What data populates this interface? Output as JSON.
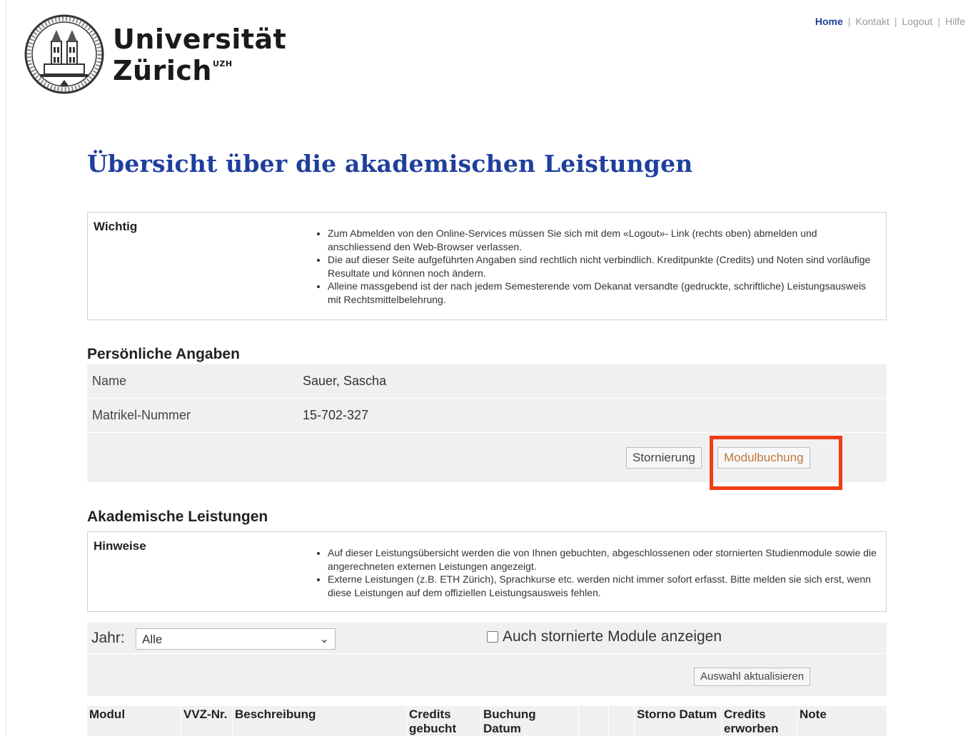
{
  "header": {
    "logo_line1": "Universität",
    "logo_line2": "Zürich",
    "logo_sup": "UZH",
    "nav": [
      {
        "label": "Home",
        "active": true
      },
      {
        "label": "Kontakt",
        "active": false
      },
      {
        "label": "Logout",
        "active": false
      },
      {
        "label": "Hilfe",
        "active": false
      }
    ],
    "separator": "|"
  },
  "page_title": "Übersicht über die akademischen Leistungen",
  "wichtig": {
    "title": "Wichtig",
    "items": [
      "Zum Abmelden von den Online-Services müssen Sie sich mit dem «Logout»- Link (rechts oben) abmelden und anschliessend den Web-Browser verlassen.",
      "Die auf dieser Seite aufgeführten Angaben sind rechtlich nicht verbindlich. Kreditpunkte (Credits) und Noten sind vorläufige Resultate und können noch ändern.",
      "Alleine massgebend ist der nach jedem Semesterende vom Dekanat versandte (gedruckte, schriftliche) Leistungsausweis mit Rechtsmittelbelehrung."
    ]
  },
  "persoenlich": {
    "heading": "Persönliche Angaben",
    "name_label": "Name",
    "name_value": "Sauer, Sascha",
    "matrikel_label": "Matrikel-Nummer",
    "matrikel_value": "15-702-327",
    "storno_button": "Stornierung",
    "modul_button": "Modulbuchung"
  },
  "akademisch": {
    "heading": "Akademische Leistungen",
    "hinweise_title": "Hinweise",
    "hinweise_items": [
      "Auf dieser Leistungsübersicht werden die von Ihnen gebuchten, abgeschlossenen oder stornierten Studienmodule sowie die angerechneten externen Leistungen angezeigt.",
      "Externe Leistungen (z.B. ETH Zürich), Sprachkurse etc. werden nicht immer sofort erfasst. Bitte melden sie sich erst, wenn diese Leistungen auf dem offiziellen Leistungsausweis fehlen."
    ],
    "jahr_label": "Jahr:",
    "jahr_value": "Alle",
    "storno_checkbox_label": "Auch stornierte Module anzeigen",
    "auswahl_button": "Auswahl aktualisieren",
    "columns": [
      {
        "label": "Modul"
      },
      {
        "label": "VVZ-Nr."
      },
      {
        "label": "Beschreibung"
      },
      {
        "label": "Credits gebucht"
      },
      {
        "label": "Buchung Datum"
      },
      {
        "label": ""
      },
      {
        "label": ""
      },
      {
        "label": "Storno Datum"
      },
      {
        "label": "Credits erworben"
      },
      {
        "label": "Note"
      }
    ]
  }
}
